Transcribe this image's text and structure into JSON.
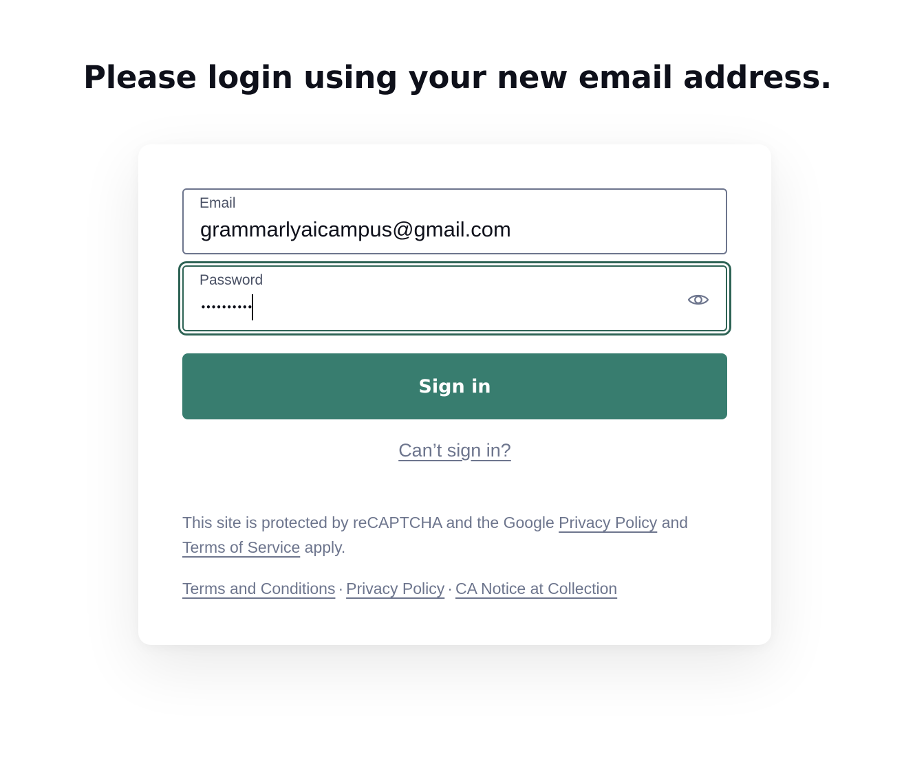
{
  "heading": "Please login using your new email address.",
  "form": {
    "email": {
      "label": "Email",
      "value": "grammarlyaicampus@gmail.com"
    },
    "password": {
      "label": "Password",
      "masked_value": "••••••••••",
      "toggle_icon": "eye-icon"
    },
    "signin_label": "Sign in",
    "cant_signin_label": "Can’t sign in?"
  },
  "recaptcha": {
    "prefix": "This site is protected by reCAPTCHA and the Google ",
    "privacy_link": "Privacy Policy",
    "middle": " and ",
    "terms_link": "Terms of Service",
    "suffix": " apply."
  },
  "footer": {
    "terms_label": "Terms and Conditions",
    "privacy_label": "Privacy Policy",
    "ca_notice_label": "CA Notice at Collection",
    "separator": "·"
  },
  "colors": {
    "accent": "#387d6f",
    "focus_ring": "#2e6355",
    "muted_text": "#6d758d",
    "heading_text": "#0e101a"
  }
}
